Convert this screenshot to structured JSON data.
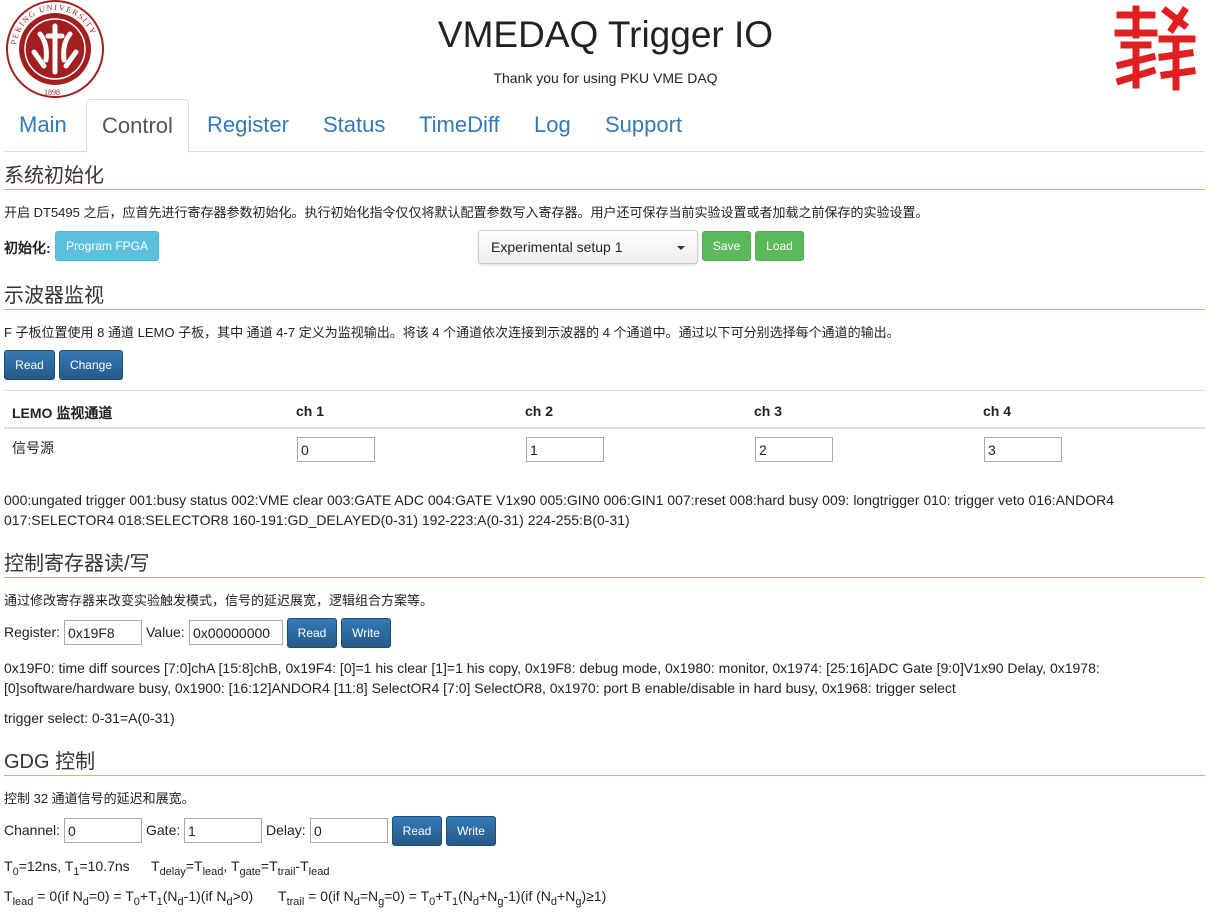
{
  "header": {
    "title": "VMEDAQ Trigger IO",
    "subtitle": "Thank you for using PKU VME DAQ",
    "logo_left_text": "PEKING UNIVERSITY 1898",
    "logo_right_text": "犭"
  },
  "tabs": [
    {
      "label": "Main",
      "active": false
    },
    {
      "label": "Control",
      "active": true
    },
    {
      "label": "Register",
      "active": false
    },
    {
      "label": "Status",
      "active": false
    },
    {
      "label": "TimeDiff",
      "active": false
    },
    {
      "label": "Log",
      "active": false
    },
    {
      "label": "Support",
      "active": false
    }
  ],
  "init": {
    "heading": "系统初始化",
    "description": "开启 DT5495 之后，应首先进行寄存器参数初始化。执行初始化指令仅仅将默认配置参数写入寄存器。用户还可保存当前实验设置或者加载之前保存的实验设置。",
    "label": "初始化:",
    "program_button": "Program FPGA",
    "setup_selected": "Experimental setup 1",
    "save_button": "Save",
    "load_button": "Load"
  },
  "scope": {
    "heading": "示波器监视",
    "description": "F 子板位置使用 8 通道 LEMO 子板，其中 通道 4-7 定义为监视输出。将该 4 个通道依次连接到示波器的 4 个通道中。通过以下可分别选择每个通道的输出。",
    "read_button": "Read",
    "change_button": "Change",
    "table_header": [
      "LEMO 监视通道",
      "ch 1",
      "ch 2",
      "ch 3",
      "ch 4"
    ],
    "row_label": "信号源",
    "values": [
      "0",
      "1",
      "2",
      "3"
    ],
    "legend_line1": "000:ungated trigger 001:busy status 002:VME clear 003:GATE ADC 004:GATE V1x90 005:GIN0 006:GIN1 007:reset 008:hard busy 009: longtrigger 010: trigger veto 016:ANDOR4",
    "legend_line2": "017:SELECTOR4 018:SELECTOR8 160-191:GD_DELAYED(0-31) 192-223:A(0-31) 224-255:B(0-31)"
  },
  "regs": {
    "heading": "控制寄存器读/写",
    "description": "通过修改寄存器来改变实验触发模式，信号的延迟展宽，逻辑组合方案等。",
    "register_label": "Register:",
    "register_value": "0x19F8",
    "value_label": "Value:",
    "value_value": "0x00000000",
    "read_button": "Read",
    "write_button": "Write",
    "help_line1": "0x19F0: time diff sources [7:0]chA [15:8]chB, 0x19F4: [0]=1 his clear [1]=1 his copy, 0x19F8: debug mode, 0x1980: monitor, 0x1974: [25:16]ADC Gate [9:0]V1x90 Delay, 0x1978:",
    "help_line2": "[0]software/hardware busy, 0x1900: [16:12]ANDOR4 [11:8] SelectOR4 [7:0] SelectOR8, 0x1970: port B enable/disable in hard busy, 0x1968: trigger select",
    "trigger_select": "trigger select: 0-31=A(0-31)"
  },
  "gdg": {
    "heading": "GDG 控制",
    "description": "控制 32 通道信号的延迟和展宽。",
    "channel_label": "Channel:",
    "channel_value": "0",
    "gate_label": "Gate:",
    "gate_value": "1",
    "delay_label": "Delay:",
    "delay_value": "0",
    "read_button": "Read",
    "write_button": "Write"
  },
  "formula": {
    "T": "T",
    "t0_sub": "0",
    "t0_val": "=12ns, ",
    "t1_sub": "1",
    "t1_val": "=10.7ns",
    "delay_sub": "delay",
    "lead_sub": "lead",
    "gate_sub": "gate",
    "trail_sub": "trail",
    "eq": "=",
    "comma": ", ",
    "minus": "-",
    "l2_a": " = 0(if N",
    "d_sub": "d",
    "l2_b": "=0) = T",
    "l2_c": "+T",
    "l2_d": "(N",
    "l2_e": "-1)(if N",
    "l2_f": ">0)",
    "l2_g": " = 0(if N",
    "g_sub": "g",
    "l2_h": "=N",
    "l2_i": "=0) = T",
    "l2_j": "+T",
    "l2_k": "(N",
    "l2_l": "+N",
    "l2_m": "-1)(if (N",
    "l2_n": "+N",
    "l2_o": ")≥1)"
  },
  "colors": {
    "link": "#337ab7",
    "heading_rule": "#e0b060",
    "logo_red": "#a31f1f",
    "right_logo_red": "#e02020"
  }
}
